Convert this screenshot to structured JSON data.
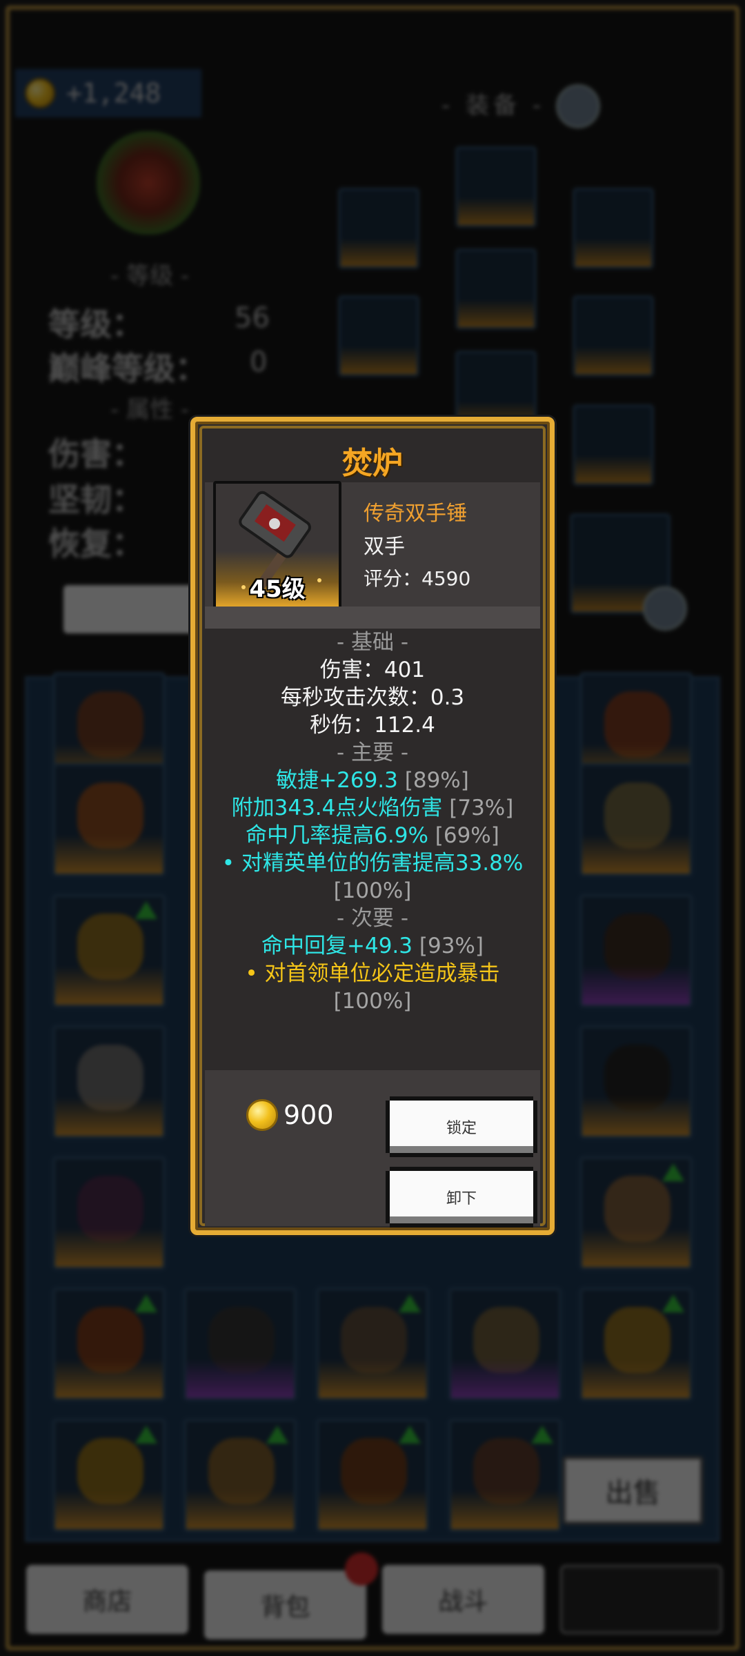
{
  "background": {
    "gold_amount": "+1,248",
    "equip_title": "- 装备 -",
    "level_section": "- 等级 -",
    "level_label": "等级：",
    "level_value": "56",
    "peak_label": "巅峰等级：",
    "peak_value": "0",
    "attr_section": "- 属性 -",
    "damage_label": "伤害：",
    "toughness_label": "坚韧：",
    "recovery_label": "恢复：",
    "sell_button": "出售",
    "tabs": [
      {
        "label": "商店"
      },
      {
        "label": "背包"
      },
      {
        "label": "战斗"
      }
    ]
  },
  "popup": {
    "title": "焚炉",
    "item": {
      "rarity_type": "传奇双手锤",
      "slot": "双手",
      "score": "评分：4590",
      "level": "45级"
    },
    "basic_header": "- 基础 -",
    "basic": [
      "伤害：401",
      "每秒攻击次数：0.3",
      "秒伤：112.4"
    ],
    "primary_header": "- 主要 -",
    "primary": [
      {
        "text": "敏捷+269.3",
        "pct": "[89%]"
      },
      {
        "text": "附加343.4点火焰伤害",
        "pct": "[73%]"
      },
      {
        "text": "命中几率提高6.9%",
        "pct": "[69%]"
      },
      {
        "text": "• 对精英单位的伤害提高33.8%",
        "pct": "[100%]"
      }
    ],
    "secondary_header": "- 次要 -",
    "secondary": [
      {
        "text": "命中回复+49.3",
        "pct": "[93%]"
      },
      {
        "text": "• 对首领单位必定造成暴击",
        "pct": "[100%]"
      }
    ],
    "price": "900",
    "lock_button": "锁定",
    "unequip_button": "卸下"
  },
  "colors": {
    "gold_border": "#e6ac35",
    "legendary": "#f0a030",
    "affix_primary": "#2ee6e6",
    "affix_special": "#f5c518"
  }
}
